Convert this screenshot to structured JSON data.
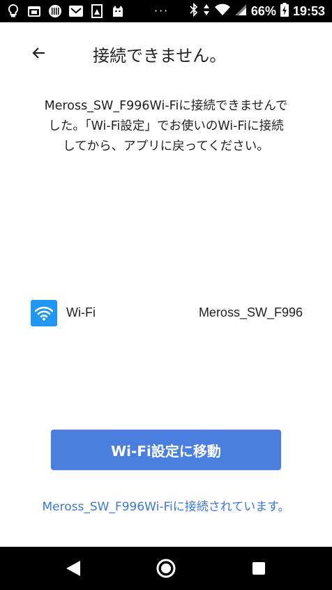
{
  "status_bar": {
    "left_icons": [
      "lightbulb-icon",
      "calendar-icon",
      "barcode-icon",
      "mail-icon",
      "image-icon",
      "cat-icon"
    ],
    "overflow": "···",
    "battery_percent": "66%",
    "time": "19:53"
  },
  "header": {
    "title": "接続できません。"
  },
  "message": {
    "line1": "Meross_SW_F996Wi-Fiに接続できませんで",
    "line2": "した。「Wi-Fi設定」でお使いのWi-Fiに接続",
    "line3": "してから、アプリに戻ってください。"
  },
  "wifi": {
    "label": "Wi-Fi",
    "ssid": "Meross_SW_F996"
  },
  "actions": {
    "primary_label": "Wi-Fi設定に移動",
    "link_text": "Meross_SW_F996Wi-Fiに接続されています。"
  },
  "colors": {
    "accent": "#4a7fe0",
    "link": "#3a78d4",
    "wifi_icon_bg": "#2196f3"
  }
}
